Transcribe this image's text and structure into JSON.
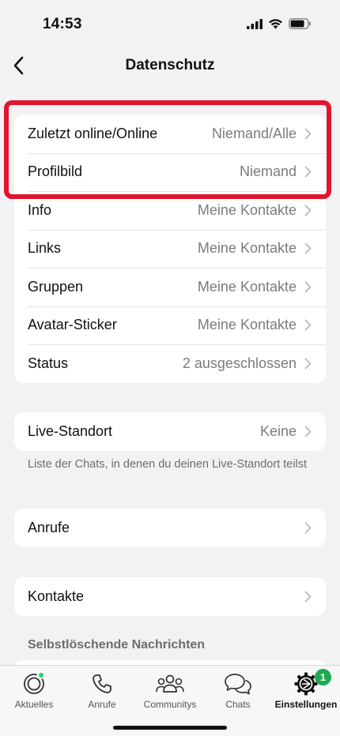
{
  "status_bar": {
    "time": "14:53"
  },
  "nav": {
    "title": "Datenschutz",
    "back_icon": "chevron-left-icon"
  },
  "group1": {
    "rows": [
      {
        "label": "Zuletzt online/Online",
        "value": "Niemand/Alle"
      },
      {
        "label": "Profilbild",
        "value": "Niemand"
      },
      {
        "label": "Info",
        "value": "Meine Kontakte"
      },
      {
        "label": "Links",
        "value": "Meine Kontakte"
      },
      {
        "label": "Gruppen",
        "value": "Meine Kontakte"
      },
      {
        "label": "Avatar-Sticker",
        "value": "Meine Kontakte"
      },
      {
        "label": "Status",
        "value": "2 ausgeschlossen"
      }
    ]
  },
  "live_location": {
    "label": "Live-Standort",
    "value": "Keine",
    "footnote": "Liste der Chats, in denen du deinen Live-Standort teilst"
  },
  "calls": {
    "label": "Anrufe"
  },
  "contacts": {
    "label": "Kontakte"
  },
  "disappearing": {
    "header": "Selbstlöschende Nachrichten"
  },
  "tab_bar": {
    "tabs": [
      {
        "label": "Aktuelles",
        "icon": "updates-icon"
      },
      {
        "label": "Anrufe",
        "icon": "phone-icon"
      },
      {
        "label": "Communitys",
        "icon": "communities-icon"
      },
      {
        "label": "Chats",
        "icon": "chats-icon"
      },
      {
        "label": "Einstellungen",
        "icon": "settings-gear-icon",
        "badge": "1",
        "active": true
      }
    ]
  },
  "colors": {
    "highlight": "#e2152e",
    "badge": "#1da851",
    "background": "#f2f2f4"
  }
}
